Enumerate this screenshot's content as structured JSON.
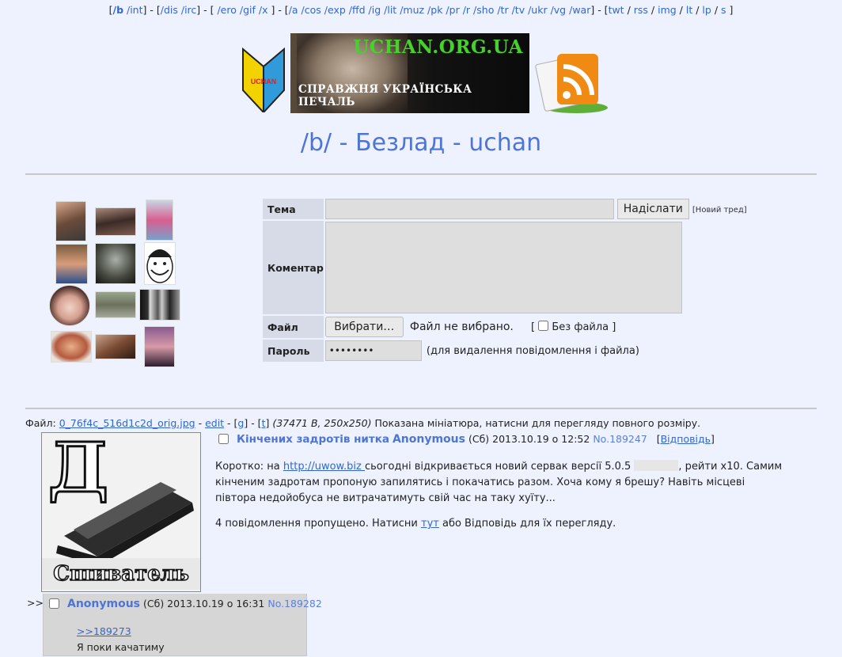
{
  "nav": {
    "b": "/b",
    "int": "/int",
    "dis": "/dis",
    "irc": "/irc",
    "ero": "/ero",
    "gif": "/gif",
    "x": "/x",
    "a": "/a",
    "cos": "/cos",
    "exp": "/exp",
    "ffd": "/ffd",
    "ig": "/ig",
    "lit": "/lit",
    "muz": "/muz",
    "pk": "/pk",
    "pr": "/pr",
    "r": "/r",
    "sho": "/sho",
    "tr": "/tr",
    "tv": "/tv",
    "ukr": "/ukr",
    "vg": "/vg",
    "war": "/war",
    "twt": "twt",
    "rss": "rss",
    "img": "img",
    "lt": "lt",
    "lp": "lp",
    "s": "s"
  },
  "banner": {
    "site": "UCHAN.ORG.UA",
    "tagline": "СПРАВЖНЯ УКРАЇНСЬКА ПЕЧАЛЬ",
    "badge": "UCHAN"
  },
  "board_title": "/b/ - Безлад - uchan",
  "form": {
    "subject_label": "Тема",
    "submit_label": "Надіслати",
    "new_thread_note": "[Новий тред]",
    "comment_label": "Коментар",
    "file_label": "Файл",
    "choose_button": "Вибрати…",
    "no_file_text": "Файл не вибрано.",
    "no_file_open": "[",
    "no_file_label": "Без файла ]",
    "password_label": "Пароль",
    "password_value": "••••••••",
    "password_hint": "(для видалення повідомлення і файла)"
  },
  "op": {
    "file_prefix": "Файл:",
    "filename": "0_76f4c_516d1c2d_orig.jpg",
    "edit": "edit",
    "g": "g",
    "t": "t",
    "file_info": "(37471 B, 250x250)",
    "file_note": "Показана мініатюра, натисни для перегляду повного розміру.",
    "image_caption": "Сшиватель",
    "image_letter": "Д",
    "subject": "Кінчених задротів нитка",
    "name": "Anonymous",
    "date": "(Сб) 2013.10.19 о 12:52",
    "number": "No.189247",
    "reply_link": "Відповідь",
    "body_part1": "Коротко: на ",
    "body_link": "http://uwow.biz ",
    "body_part2": "сьогодні відкривається новий сервак версії 5.0.5 ",
    "body_part3": ", рейти x10. Самим кінченим задротам пропоную запилятись і покачатись разом. Хоча кому я брешу? Навіть місцеві півтора недойобуса не витрачатимуть свій час на таку хуїту...",
    "omitted_part1": "4 повідомлення пропущено. Натисни ",
    "omitted_link": "тут",
    "omitted_part2": " або Відповідь для їх перегляду."
  },
  "reply": {
    "arrow": ">>",
    "name": "Anonymous",
    "date": "(Сб) 2013.10.19 о 16:31",
    "number": "No.189282",
    "quote": ">>189273",
    "text": "Я поки качатиму"
  }
}
